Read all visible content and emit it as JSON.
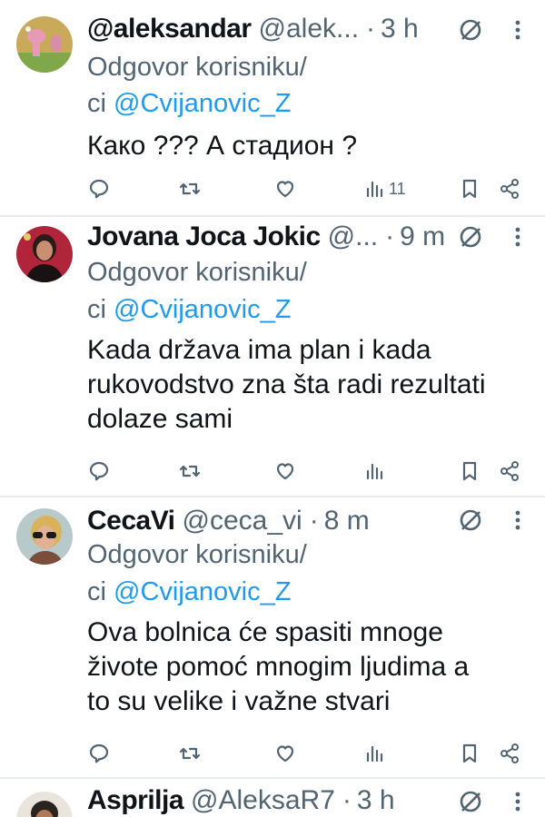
{
  "tweets": [
    {
      "name": "@aleksandar",
      "handle": "@alek...",
      "dot": "·",
      "time": "3 h",
      "reply_prefix": "Odgovor korisniku/",
      "reply_prefix2": "ci",
      "reply_to": "@Cvijanovic_Z",
      "lines": [
        "Како ??? А стадион ?"
      ],
      "views": "11",
      "avatar": "cartoon-pink-panther-avatar"
    },
    {
      "name": "Jovana Joca Jokic",
      "handle": "@...",
      "dot": "·",
      "time": "9 m",
      "reply_prefix": "Odgovor korisniku/",
      "reply_prefix2": "ci",
      "reply_to": "@Cvijanovic_Z",
      "lines": [
        "Kada država ima plan i kada",
        "rukovodstvo zna šta radi rezultati",
        "dolaze sami"
      ],
      "views": "",
      "avatar": "woman-portrait-avatar"
    },
    {
      "name": "CecaVi",
      "handle": "@ceca_vi",
      "dot": "·",
      "time": "8 m",
      "reply_prefix": "Odgovor korisniku/",
      "reply_prefix2": "ci",
      "reply_to": "@Cvijanovic_Z",
      "lines": [
        "Ova bolnica će spasiti mnoge",
        "živote pomoć mnogim ljudima a",
        "to su velike i važne stvari"
      ],
      "views": "",
      "avatar": "woman-sunglasses-avatar"
    },
    {
      "name": "Asprilja",
      "handle": "@AleksaR7",
      "dot": "·",
      "time": "3 h",
      "avatar": "man-portrait-avatar"
    }
  ],
  "colors": {
    "accent": "#1d9bf0",
    "muted": "#536471",
    "text": "#0f1419",
    "divider": "#e6ecf0"
  }
}
